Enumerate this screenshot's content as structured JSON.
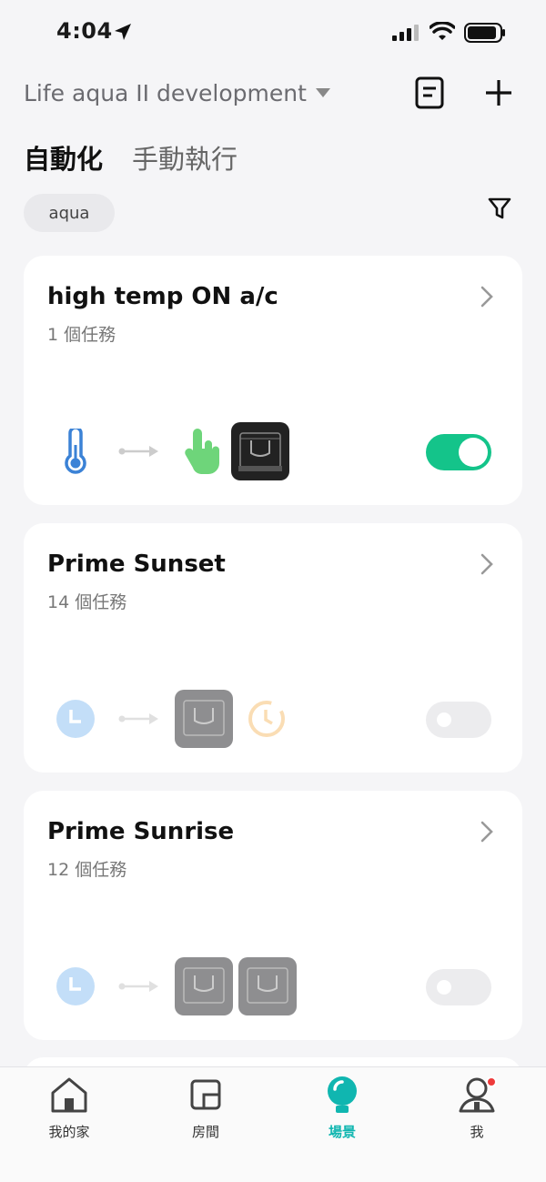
{
  "status_bar": {
    "time": "4:04"
  },
  "header": {
    "home_name": "Life aqua II development"
  },
  "tabs": {
    "active": "自動化",
    "inactive": "手動執行"
  },
  "filter": {
    "chip": "aqua"
  },
  "cards": [
    {
      "title": "high temp ON a/c",
      "subtitle": "1 個任務",
      "enabled": true
    },
    {
      "title": "Prime Sunset",
      "subtitle": "14 個任務",
      "enabled": false
    },
    {
      "title": "Prime Sunrise",
      "subtitle": "12 個任務",
      "enabled": false
    }
  ],
  "tabbar": [
    {
      "label": "我的家",
      "icon": "home-icon"
    },
    {
      "label": "房間",
      "icon": "room-icon"
    },
    {
      "label": "場景",
      "icon": "scene-icon",
      "active": true
    },
    {
      "label": "我",
      "icon": "profile-icon"
    }
  ],
  "colors": {
    "accent": "#14c48a",
    "tab_active": "#10b6b0",
    "badge": "#ee3b3b"
  }
}
